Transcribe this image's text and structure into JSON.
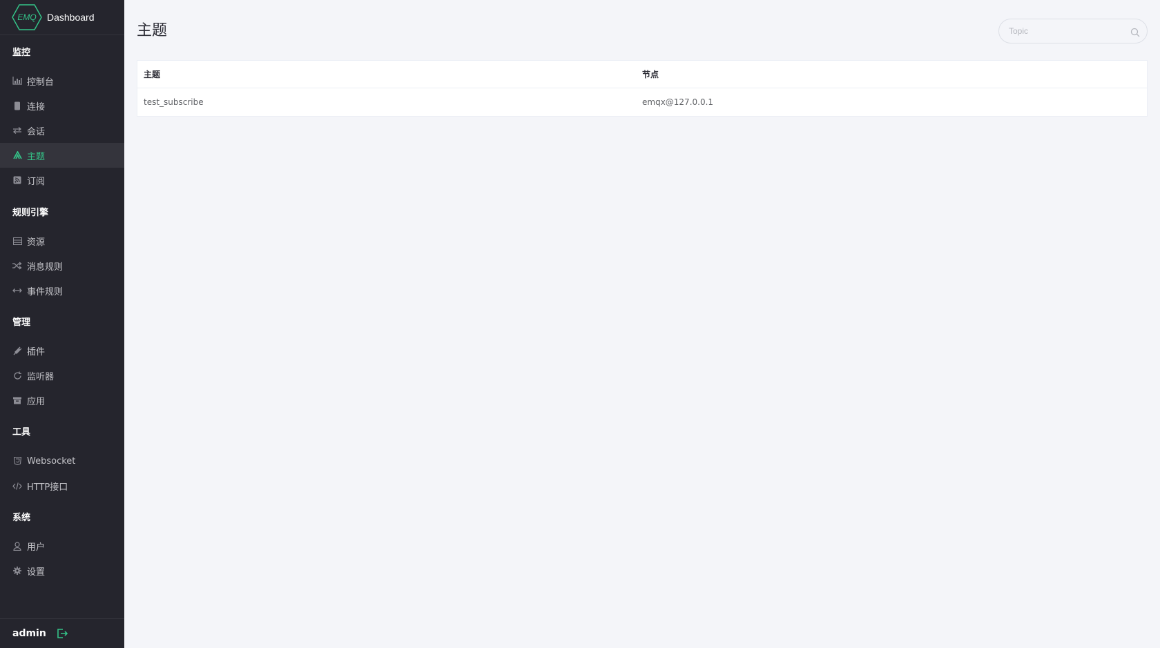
{
  "brand": {
    "logo_text": "EMQ",
    "title": "Dashboard",
    "accent_color": "#34c388"
  },
  "sidebar": {
    "groups": [
      {
        "title": "监控",
        "items": [
          {
            "label": "控制台",
            "icon": "bar-chart-icon"
          },
          {
            "label": "连接",
            "icon": "mobile-icon"
          },
          {
            "label": "会话",
            "icon": "exchange-icon"
          },
          {
            "label": "主题",
            "icon": "topic-icon",
            "active": true
          },
          {
            "label": "订阅",
            "icon": "rss-icon"
          }
        ]
      },
      {
        "title": "规则引擎",
        "items": [
          {
            "label": "资源",
            "icon": "list-icon"
          },
          {
            "label": "消息规则",
            "icon": "shuffle-icon"
          },
          {
            "label": "事件规则",
            "icon": "arrows-h-icon"
          }
        ]
      },
      {
        "title": "管理",
        "items": [
          {
            "label": "插件",
            "icon": "plug-icon"
          },
          {
            "label": "监听器",
            "icon": "refresh-icon"
          },
          {
            "label": "应用",
            "icon": "archive-icon"
          }
        ]
      },
      {
        "title": "工具",
        "items": [
          {
            "label": "Websocket",
            "icon": "html5-icon"
          },
          {
            "label": "HTTP接口",
            "icon": "code-icon"
          }
        ]
      },
      {
        "title": "系统",
        "items": [
          {
            "label": "用户",
            "icon": "user-icon"
          },
          {
            "label": "设置",
            "icon": "gear-icon"
          }
        ]
      }
    ]
  },
  "user": {
    "name": "admin"
  },
  "main": {
    "title": "主题",
    "search": {
      "placeholder": "Topic",
      "value": ""
    },
    "table": {
      "columns": [
        "主题",
        "节点"
      ],
      "rows": [
        [
          "test_subscribe",
          "emqx@127.0.0.1"
        ]
      ]
    }
  }
}
